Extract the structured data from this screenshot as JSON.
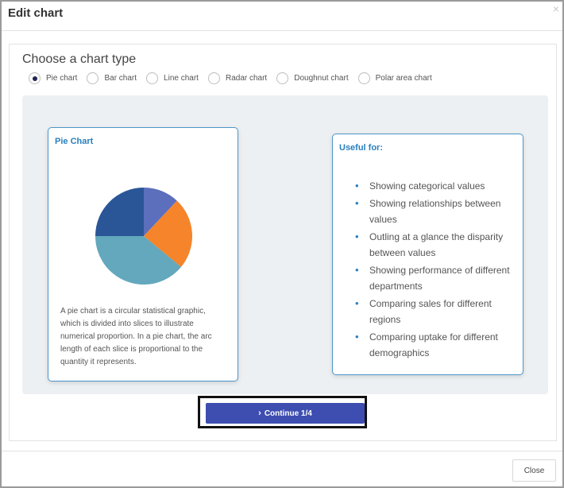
{
  "dialog": {
    "title": "Edit chart",
    "close_icon": "×",
    "close_label": "Close"
  },
  "choose": {
    "title": "Choose a chart type",
    "options": [
      {
        "label": "Pie chart",
        "checked": true
      },
      {
        "label": "Bar chart",
        "checked": false
      },
      {
        "label": "Line chart",
        "checked": false
      },
      {
        "label": "Radar chart",
        "checked": false
      },
      {
        "label": "Doughnut chart",
        "checked": false
      },
      {
        "label": "Polar area chart",
        "checked": false
      }
    ]
  },
  "preview": {
    "chart_title": "Pie Chart",
    "description": "A pie chart is a circular statistical graphic, which is divided into slices to illustrate numerical proportion. In a pie chart, the arc length of each slice is proportional to the quantity it represents.",
    "useful_title": "Useful for:",
    "useful_items": [
      "Showing categorical values",
      "Showing relationships between values",
      "Outling at a glance the disparity between values",
      "Showing performance of different departments",
      "Comparing sales for different regions",
      "Comparing uptake for different demographics"
    ]
  },
  "chart_data": {
    "type": "pie",
    "values": [
      12,
      24,
      39,
      25
    ],
    "colors": [
      "#5b6fbd",
      "#f5842a",
      "#63a8bd",
      "#2a5698"
    ]
  },
  "continue": {
    "icon": "chevron-right-icon",
    "label": "Continue 1/4"
  }
}
